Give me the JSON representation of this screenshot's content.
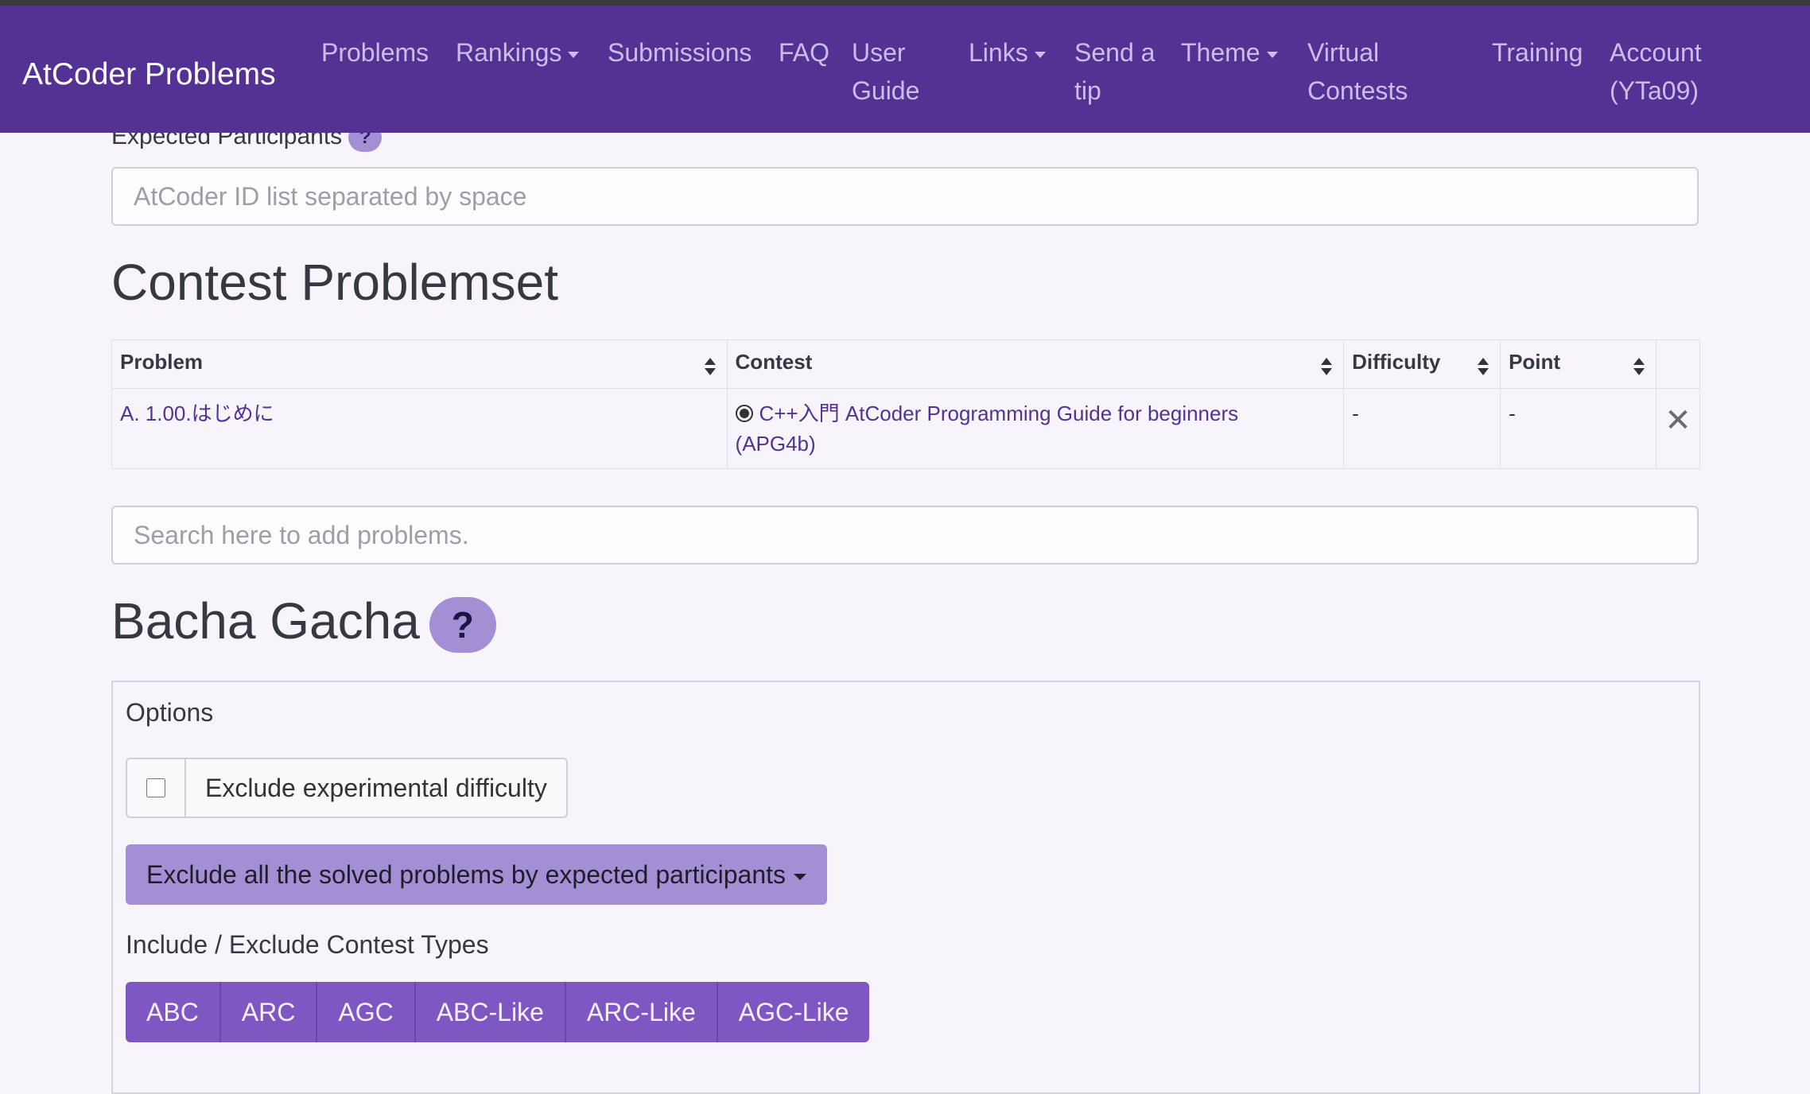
{
  "navbar": {
    "brand": "AtCoder Problems",
    "items": [
      {
        "label": "Problems"
      },
      {
        "label": "Rankings"
      },
      {
        "label": "Submissions"
      },
      {
        "label": "FAQ"
      },
      {
        "label_line1": "User",
        "label_line2": "Guide"
      },
      {
        "label": "Links"
      },
      {
        "label_line1": "Send a",
        "label_line2": "tip"
      },
      {
        "label": "Theme"
      },
      {
        "label_line1": "Virtual",
        "label_line2": "Contests"
      },
      {
        "label": "Training"
      },
      {
        "label_line1": "Account",
        "label_line2": "(YTa09)"
      }
    ]
  },
  "participants": {
    "label": "Expected Participants",
    "help": "?",
    "placeholder": "AtCoder ID list separated by space"
  },
  "problemset": {
    "title": "Contest Problemset",
    "columns": [
      "Problem",
      "Contest",
      "Difficulty",
      "Point"
    ],
    "rows": [
      {
        "problem": "A. 1.00.はじめに",
        "contest_line1": "C++入門 AtCoder Programming Guide for beginners",
        "contest_line2": "(APG4b)",
        "difficulty": "-",
        "point": "-",
        "remove": "✕"
      }
    ],
    "search_placeholder": "Search here to add problems."
  },
  "gacha": {
    "title": "Bacha Gacha",
    "help": "?",
    "options_label": "Options",
    "exclude_experimental": "Exclude experimental difficulty",
    "exclude_solved": "Exclude all the solved problems by expected participants",
    "contest_types_label": "Include / Exclude Contest Types",
    "contest_types": [
      "ABC",
      "ARC",
      "AGC",
      "ABC-Like",
      "ARC-Like",
      "AGC-Like"
    ]
  }
}
